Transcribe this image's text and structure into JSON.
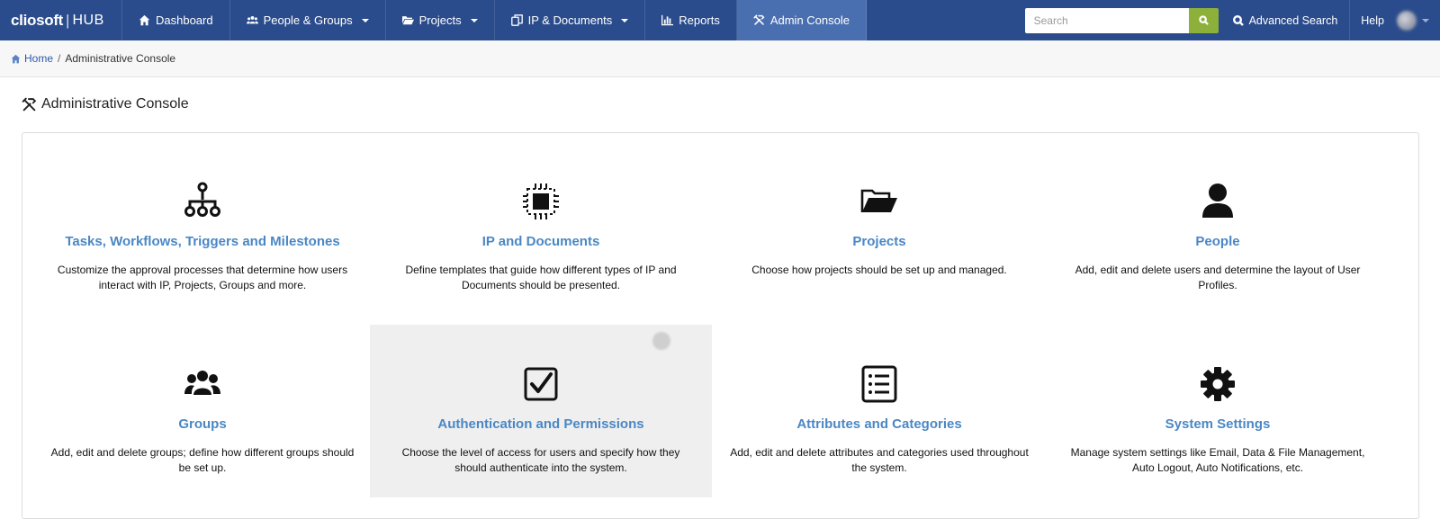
{
  "brand": {
    "logo_main": "cliosoft",
    "logo_sep": "|",
    "logo_sub": "HUB"
  },
  "nav": {
    "dashboard": "Dashboard",
    "people_groups": "People & Groups",
    "projects": "Projects",
    "ip_documents": "IP & Documents",
    "reports": "Reports",
    "admin_console": "Admin Console"
  },
  "search": {
    "placeholder": "Search",
    "value": ""
  },
  "advanced_search": "Advanced Search",
  "help": "Help",
  "breadcrumb": {
    "home": "Home",
    "sep": "/",
    "current": "Administrative Console"
  },
  "page_title": "Administrative Console",
  "tiles": [
    {
      "title": "Tasks, Workflows, Triggers and Milestones",
      "desc": "Customize the approval processes that determine how users interact with IP, Projects, Groups and more.",
      "icon": "hierarchy-icon"
    },
    {
      "title": "IP and Documents",
      "desc": "Define templates that guide how different types of IP and Documents should be presented.",
      "icon": "chip-icon"
    },
    {
      "title": "Projects",
      "desc": "Choose how projects should be set up and managed.",
      "icon": "folder-open-icon"
    },
    {
      "title": "People",
      "desc": "Add, edit and delete users and determine the layout of User Profiles.",
      "icon": "user-icon"
    },
    {
      "title": "Groups",
      "desc": "Add, edit and delete groups; define how different groups should be set up.",
      "icon": "users-icon"
    },
    {
      "title": "Authentication and Permissions",
      "desc": "Choose the level of access for users and specify how they should authenticate into the system.",
      "icon": "checkbox-icon"
    },
    {
      "title": "Attributes and Categories",
      "desc": "Add, edit and delete attributes and categories used throughout the system.",
      "icon": "list-icon"
    },
    {
      "title": "System Settings",
      "desc": "Manage system settings like Email, Data & File Management, Auto Logout, Auto Notifications, etc.",
      "icon": "gear-icon"
    }
  ],
  "colors": {
    "navbar": "#2b4c8c",
    "nav_active": "#4a6fb0",
    "search_button": "#8db03a",
    "tile_title": "#4a87c5",
    "tile_hover": "#efefef"
  }
}
